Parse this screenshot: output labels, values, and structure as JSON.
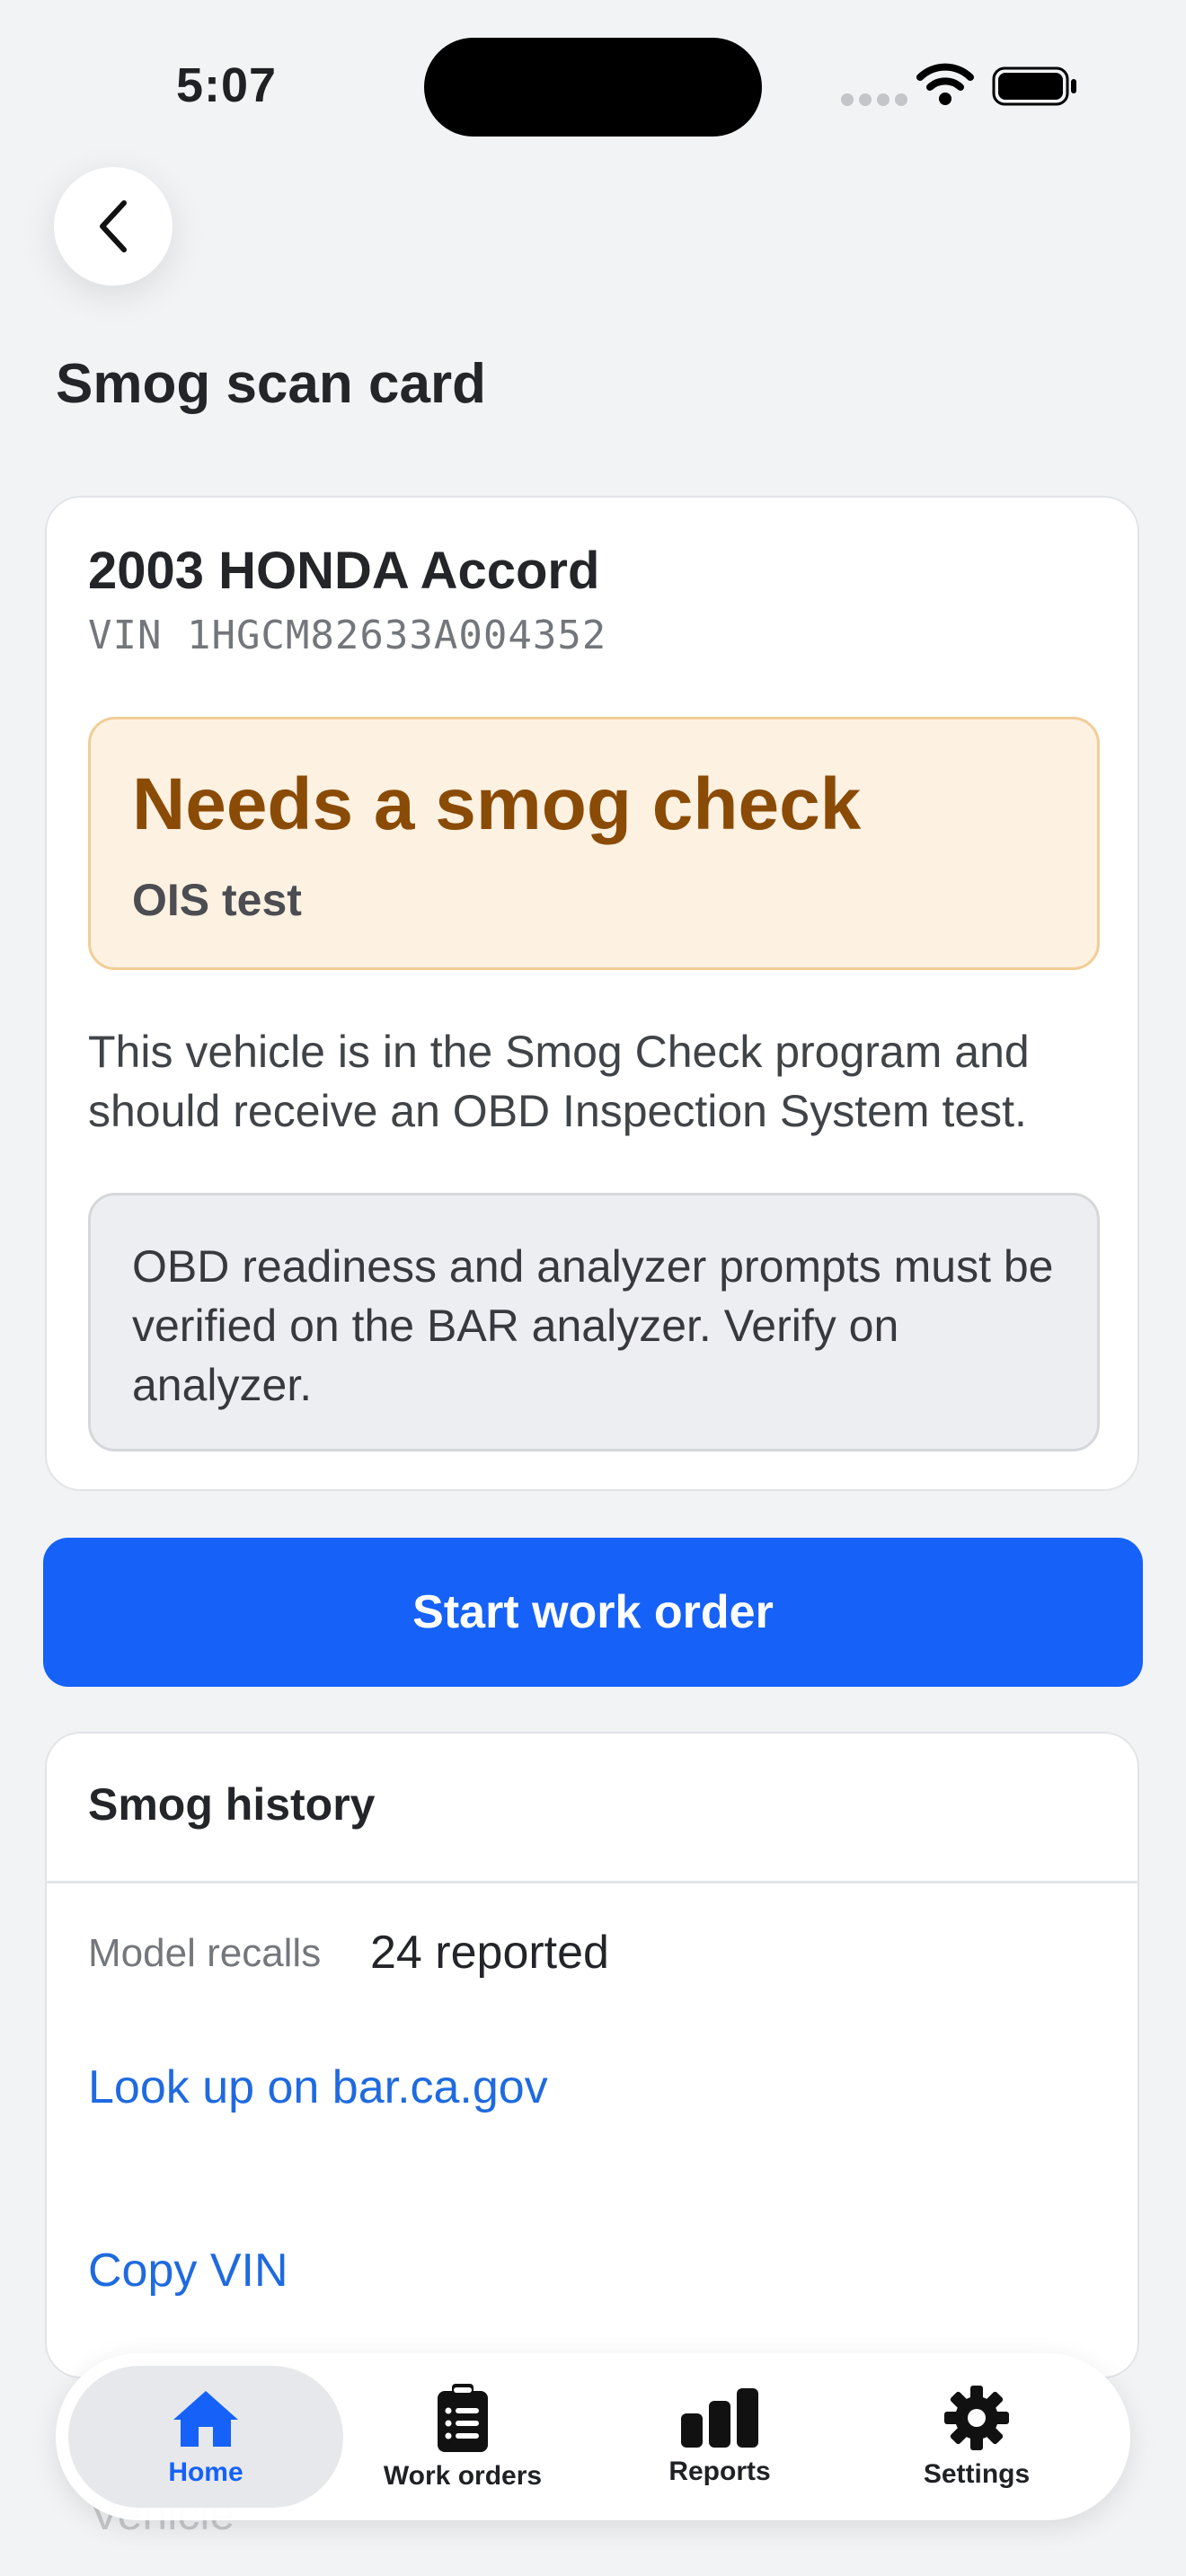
{
  "status_bar": {
    "time": "5:07"
  },
  "header": {
    "title": "Smog scan card"
  },
  "vehicle": {
    "name": "2003 HONDA Accord",
    "vin": "VIN 1HGCM82633A004352"
  },
  "alert": {
    "title": "Needs a smog check",
    "subtitle": "OIS test",
    "color": "#8a4b06",
    "background": "#fdf1e1"
  },
  "description": "This vehicle is in the Smog Check program and should receive an OBD Inspection System test.",
  "note": "OBD readiness and analyzer prompts must be verified on the BAR analyzer. Verify on analyzer.",
  "primary_action": {
    "label": "Start work order",
    "color": "#1661f8"
  },
  "history": {
    "title": "Smog history",
    "recalls_label": "Model recalls",
    "recalls_value": "24 reported",
    "lookup_link": "Look up on bar.ca.gov",
    "copy_link": "Copy VIN",
    "next_section_label": "Vehicle"
  },
  "tabbar": {
    "items": [
      {
        "label": "Home",
        "icon": "home-icon",
        "active": true
      },
      {
        "label": "Work orders",
        "icon": "clipboard-icon",
        "active": false
      },
      {
        "label": "Reports",
        "icon": "bar-chart-icon",
        "active": false
      },
      {
        "label": "Settings",
        "icon": "gear-icon",
        "active": false
      }
    ]
  }
}
